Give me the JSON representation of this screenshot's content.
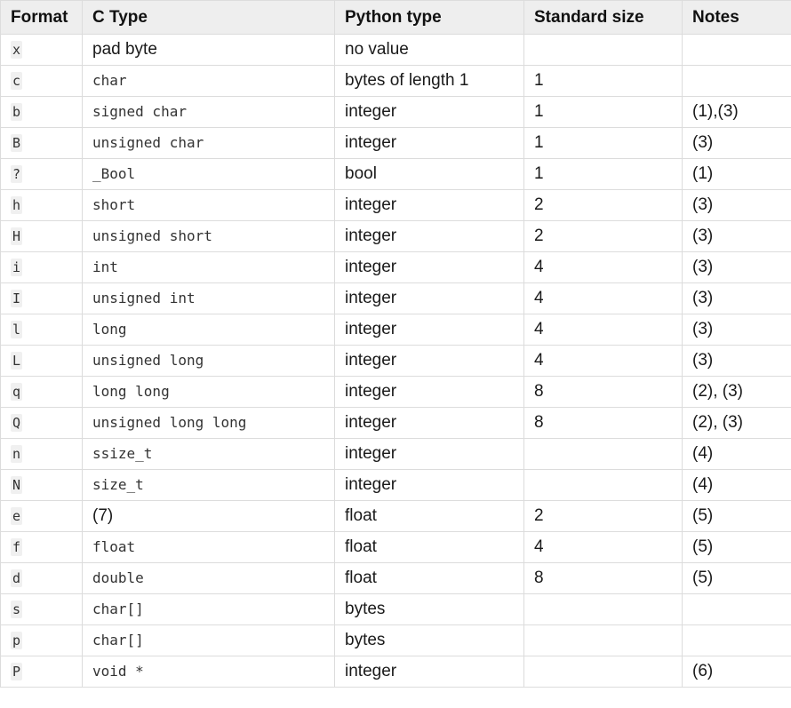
{
  "headers": {
    "format": "Format",
    "ctype": "C Type",
    "python_type": "Python type",
    "standard_size": "Standard size",
    "notes": "Notes"
  },
  "rows": [
    {
      "format": "x",
      "ctype": "pad byte",
      "ctype_is_code": false,
      "python_type": "no value",
      "standard_size": "",
      "notes": ""
    },
    {
      "format": "c",
      "ctype": "char",
      "ctype_is_code": true,
      "python_type": "bytes of length 1",
      "standard_size": "1",
      "notes": ""
    },
    {
      "format": "b",
      "ctype": "signed char",
      "ctype_is_code": true,
      "python_type": "integer",
      "standard_size": "1",
      "notes": "(1),(3)"
    },
    {
      "format": "B",
      "ctype": "unsigned char",
      "ctype_is_code": true,
      "python_type": "integer",
      "standard_size": "1",
      "notes": "(3)"
    },
    {
      "format": "?",
      "ctype": "_Bool",
      "ctype_is_code": true,
      "python_type": "bool",
      "standard_size": "1",
      "notes": "(1)"
    },
    {
      "format": "h",
      "ctype": "short",
      "ctype_is_code": true,
      "python_type": "integer",
      "standard_size": "2",
      "notes": "(3)"
    },
    {
      "format": "H",
      "ctype": "unsigned short",
      "ctype_is_code": true,
      "python_type": "integer",
      "standard_size": "2",
      "notes": "(3)"
    },
    {
      "format": "i",
      "ctype": "int",
      "ctype_is_code": true,
      "python_type": "integer",
      "standard_size": "4",
      "notes": "(3)"
    },
    {
      "format": "I",
      "ctype": "unsigned int",
      "ctype_is_code": true,
      "python_type": "integer",
      "standard_size": "4",
      "notes": "(3)"
    },
    {
      "format": "l",
      "ctype": "long",
      "ctype_is_code": true,
      "python_type": "integer",
      "standard_size": "4",
      "notes": "(3)"
    },
    {
      "format": "L",
      "ctype": "unsigned long",
      "ctype_is_code": true,
      "python_type": "integer",
      "standard_size": "4",
      "notes": "(3)"
    },
    {
      "format": "q",
      "ctype": "long long",
      "ctype_is_code": true,
      "python_type": "integer",
      "standard_size": "8",
      "notes": "(2), (3)"
    },
    {
      "format": "Q",
      "ctype": "unsigned long long",
      "ctype_is_code": true,
      "python_type": "integer",
      "standard_size": "8",
      "notes": "(2), (3)"
    },
    {
      "format": "n",
      "ctype": "ssize_t",
      "ctype_is_code": true,
      "python_type": "integer",
      "standard_size": "",
      "notes": "(4)"
    },
    {
      "format": "N",
      "ctype": "size_t",
      "ctype_is_code": true,
      "python_type": "integer",
      "standard_size": "",
      "notes": "(4)"
    },
    {
      "format": "e",
      "ctype": "(7)",
      "ctype_is_code": false,
      "python_type": "float",
      "standard_size": "2",
      "notes": "(5)"
    },
    {
      "format": "f",
      "ctype": "float",
      "ctype_is_code": true,
      "python_type": "float",
      "standard_size": "4",
      "notes": "(5)"
    },
    {
      "format": "d",
      "ctype": "double",
      "ctype_is_code": true,
      "python_type": "float",
      "standard_size": "8",
      "notes": "(5)"
    },
    {
      "format": "s",
      "ctype": "char[]",
      "ctype_is_code": true,
      "python_type": "bytes",
      "standard_size": "",
      "notes": ""
    },
    {
      "format": "p",
      "ctype": "char[]",
      "ctype_is_code": true,
      "python_type": "bytes",
      "standard_size": "",
      "notes": ""
    },
    {
      "format": "P",
      "ctype": "void *",
      "ctype_is_code": true,
      "python_type": "integer",
      "standard_size": "",
      "notes": "(6)"
    }
  ]
}
